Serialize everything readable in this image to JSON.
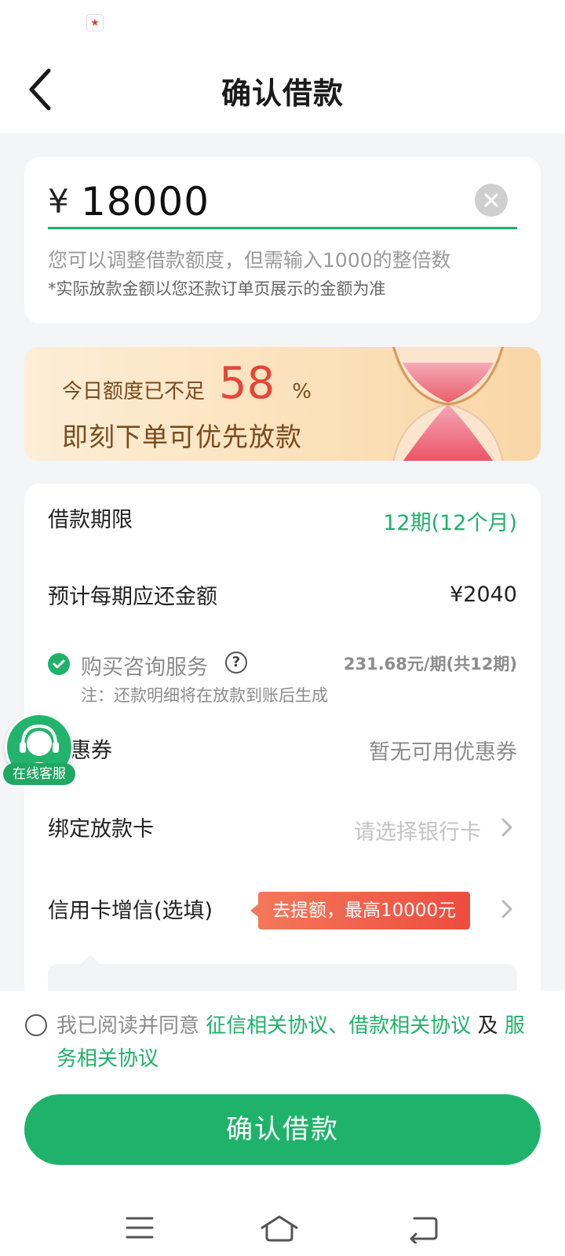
{
  "status_bar": {
    "app_icon": "app-notification-icon"
  },
  "nav": {
    "title": "确认借款",
    "back_icon": "back-arrow-icon"
  },
  "amount": {
    "currency": "¥",
    "value": "18000",
    "hint": "您可以调整借款额度，但需输入1000的整倍数",
    "note": "*实际放款金额以您还款订单页展示的金额为准"
  },
  "banner": {
    "line1_prefix": "今日额度已不足",
    "percent": "58",
    "percent_sign": "%",
    "line2": "即刻下单可优先放款"
  },
  "details": {
    "term_label": "借款期限",
    "term_value": "12期(12个月)",
    "monthly_label": "预计每期应还金额",
    "monthly_value": "¥2040",
    "service_label": "购买咨询服务",
    "service_price": "231.68元/期(共12期)",
    "service_note": "注：还款明细将在放款到账后生成",
    "coupon_label": "惠券",
    "coupon_value": "暂无可用优惠券",
    "bank_label": "绑定放款卡",
    "bank_value": "请选择银行卡",
    "credit_label": "信用卡增信(选填)",
    "credit_promo": "去提额，最高10000元"
  },
  "customer_service": {
    "label": "在线客服"
  },
  "agreement": {
    "prefix": "我已阅读并同意",
    "link1": "征信相关协议、",
    "link2": "借款相关协议",
    "connector": "及",
    "link3": "服务相关协议"
  },
  "confirm_button": "确认借款",
  "colors": {
    "accent": "#1fb26a",
    "highlight": "#e5463a",
    "banner_text": "#7a4a1e"
  }
}
